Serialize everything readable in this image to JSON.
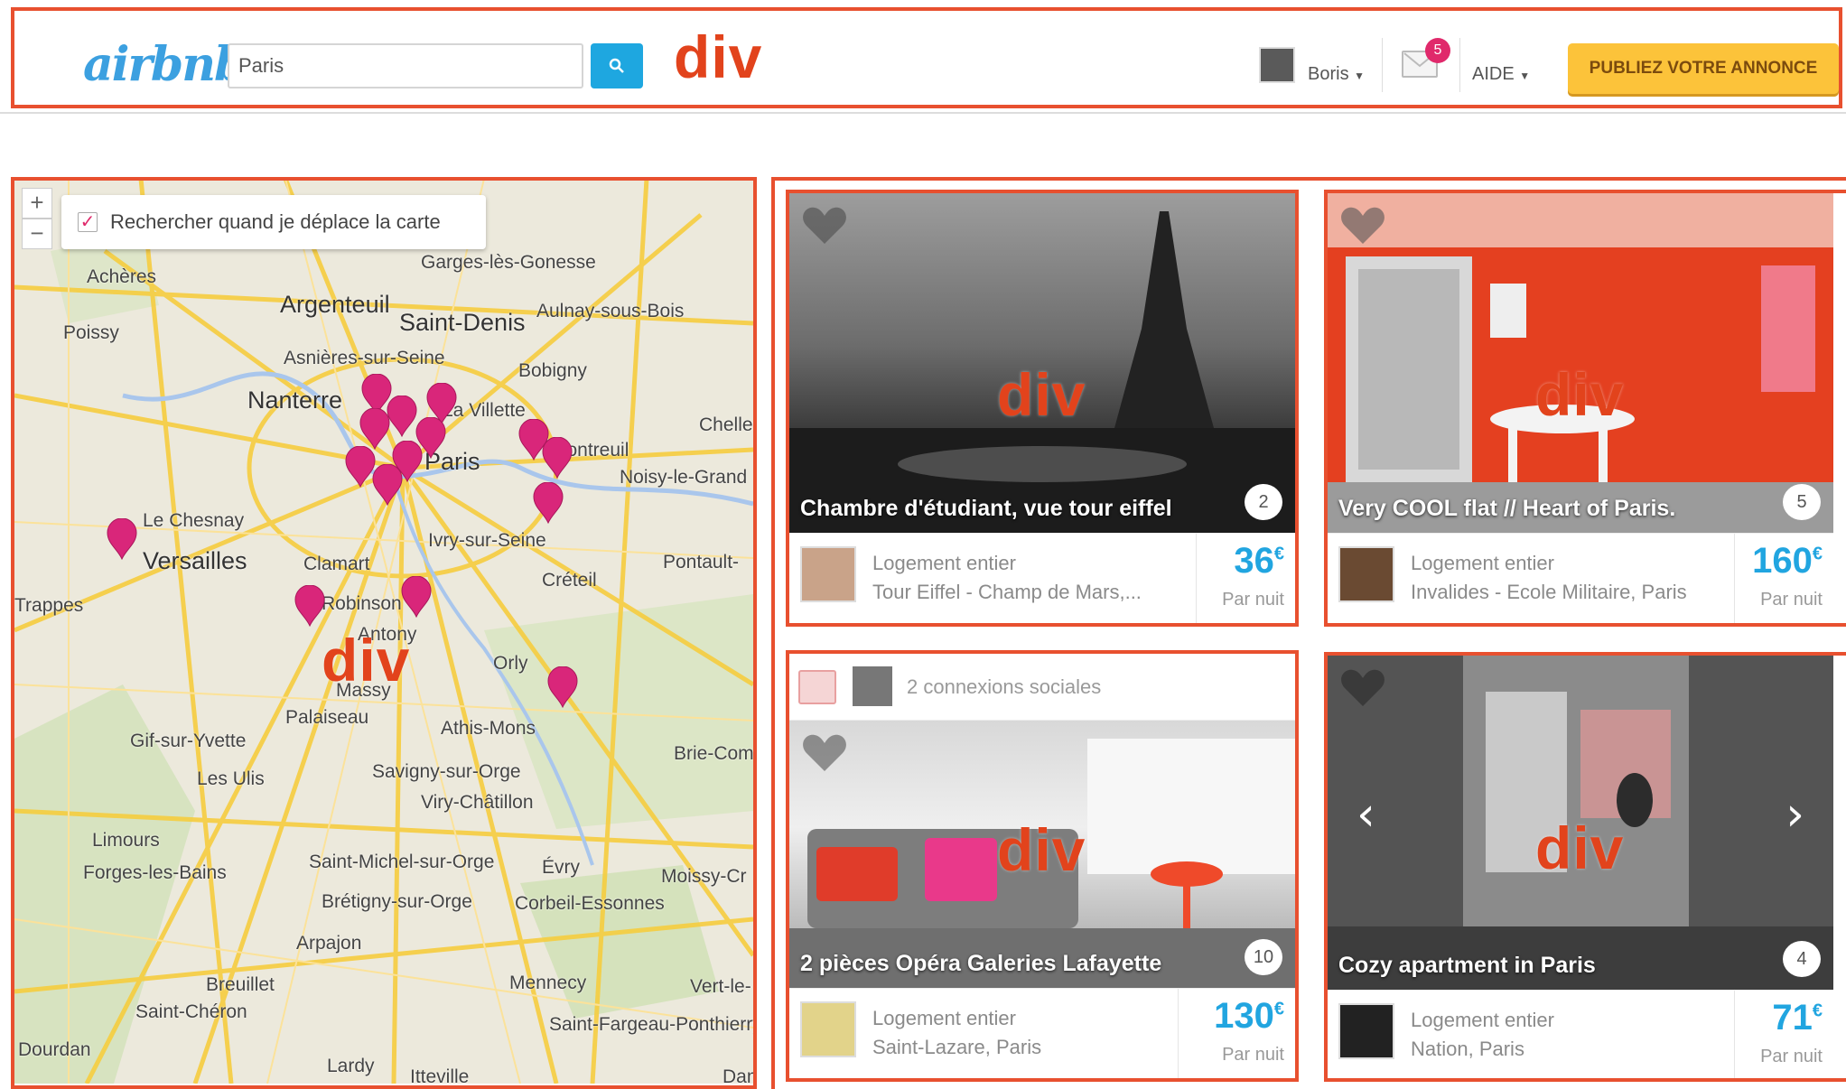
{
  "header": {
    "logo": "airbnb",
    "search_value": "Paris",
    "user_name": "Boris",
    "mail_count": "5",
    "help_label": "AIDE",
    "publish_label": "PUBLIEZ VOTRE ANNONCE",
    "overlay_label": "div"
  },
  "map": {
    "zoom_in": "+",
    "zoom_out": "−",
    "toggle_label": "Rechercher quand je déplace la carte",
    "overlay_label": "div",
    "places": [
      "Achères",
      "Poissy",
      "Argenteuil",
      "Saint-Denis",
      "Aulnay-sous-Bois",
      "Garges-lès-Gonesse",
      "Asnières-sur-Seine",
      "Bobigny",
      "Nanterre",
      "La Villette",
      "Paris",
      "Montreuil",
      "Noisy-le-Grand",
      "Le Chesnay",
      "Versailles",
      "Clamart",
      "Ivry-sur-Seine",
      "Créteil",
      "Pontault-",
      "Trappes",
      "Robinson",
      "Antony",
      "Orly",
      "Massy",
      "Palaiseau",
      "Athis-Mons",
      "Gif-sur-Yvette",
      "Les Ulis",
      "Savigny-sur-Orge",
      "Viry-Châtillon",
      "Limours",
      "Forges-les-Bains",
      "Saint-Michel-sur-Orge",
      "Évry",
      "Brétigny-sur-Orge",
      "Corbeil-Essonnes",
      "Arpajon",
      "Breuillet",
      "Saint-Chéron",
      "Mennecy",
      "Dourdan",
      "Lardy",
      "Itteville",
      "Brie-Com",
      "Chelles",
      "Moissy-Cr",
      "Vert-le-",
      "Saint-Fargeau-Ponthierry",
      "Dam"
    ]
  },
  "listings_overlay_label": "div",
  "listings": [
    {
      "title": "Chambre d'étudiant, vue tour eiffel",
      "count": "2",
      "type": "Logement entier",
      "location": "Tour Eiffel - Champ de Mars,...",
      "price": "36",
      "currency": "€",
      "unit": "Par nuit",
      "overlay": "div"
    },
    {
      "title": "Very COOL flat // Heart of Paris.",
      "count": "5",
      "type": "Logement entier",
      "location": "Invalides - Ecole Militaire, Paris",
      "price": "160",
      "currency": "€",
      "unit": "Par nuit",
      "overlay": "div"
    },
    {
      "title": "2 pièces Opéra Galeries Lafayette",
      "count": "10",
      "type": "Logement entier",
      "location": "Saint-Lazare, Paris",
      "price": "130",
      "currency": "€",
      "unit": "Par nuit",
      "overlay": "div",
      "social": "2 connexions sociales"
    },
    {
      "title": "Cozy apartment in Paris",
      "count": "4",
      "type": "Logement entier",
      "location": "Nation, Paris",
      "price": "71",
      "currency": "€",
      "unit": "Par nuit",
      "overlay": "div"
    }
  ],
  "colors": {
    "accent": "#21a5e0",
    "pin": "#d9267a",
    "highlight_box": "#e8502f",
    "publish": "#fcc33a"
  }
}
